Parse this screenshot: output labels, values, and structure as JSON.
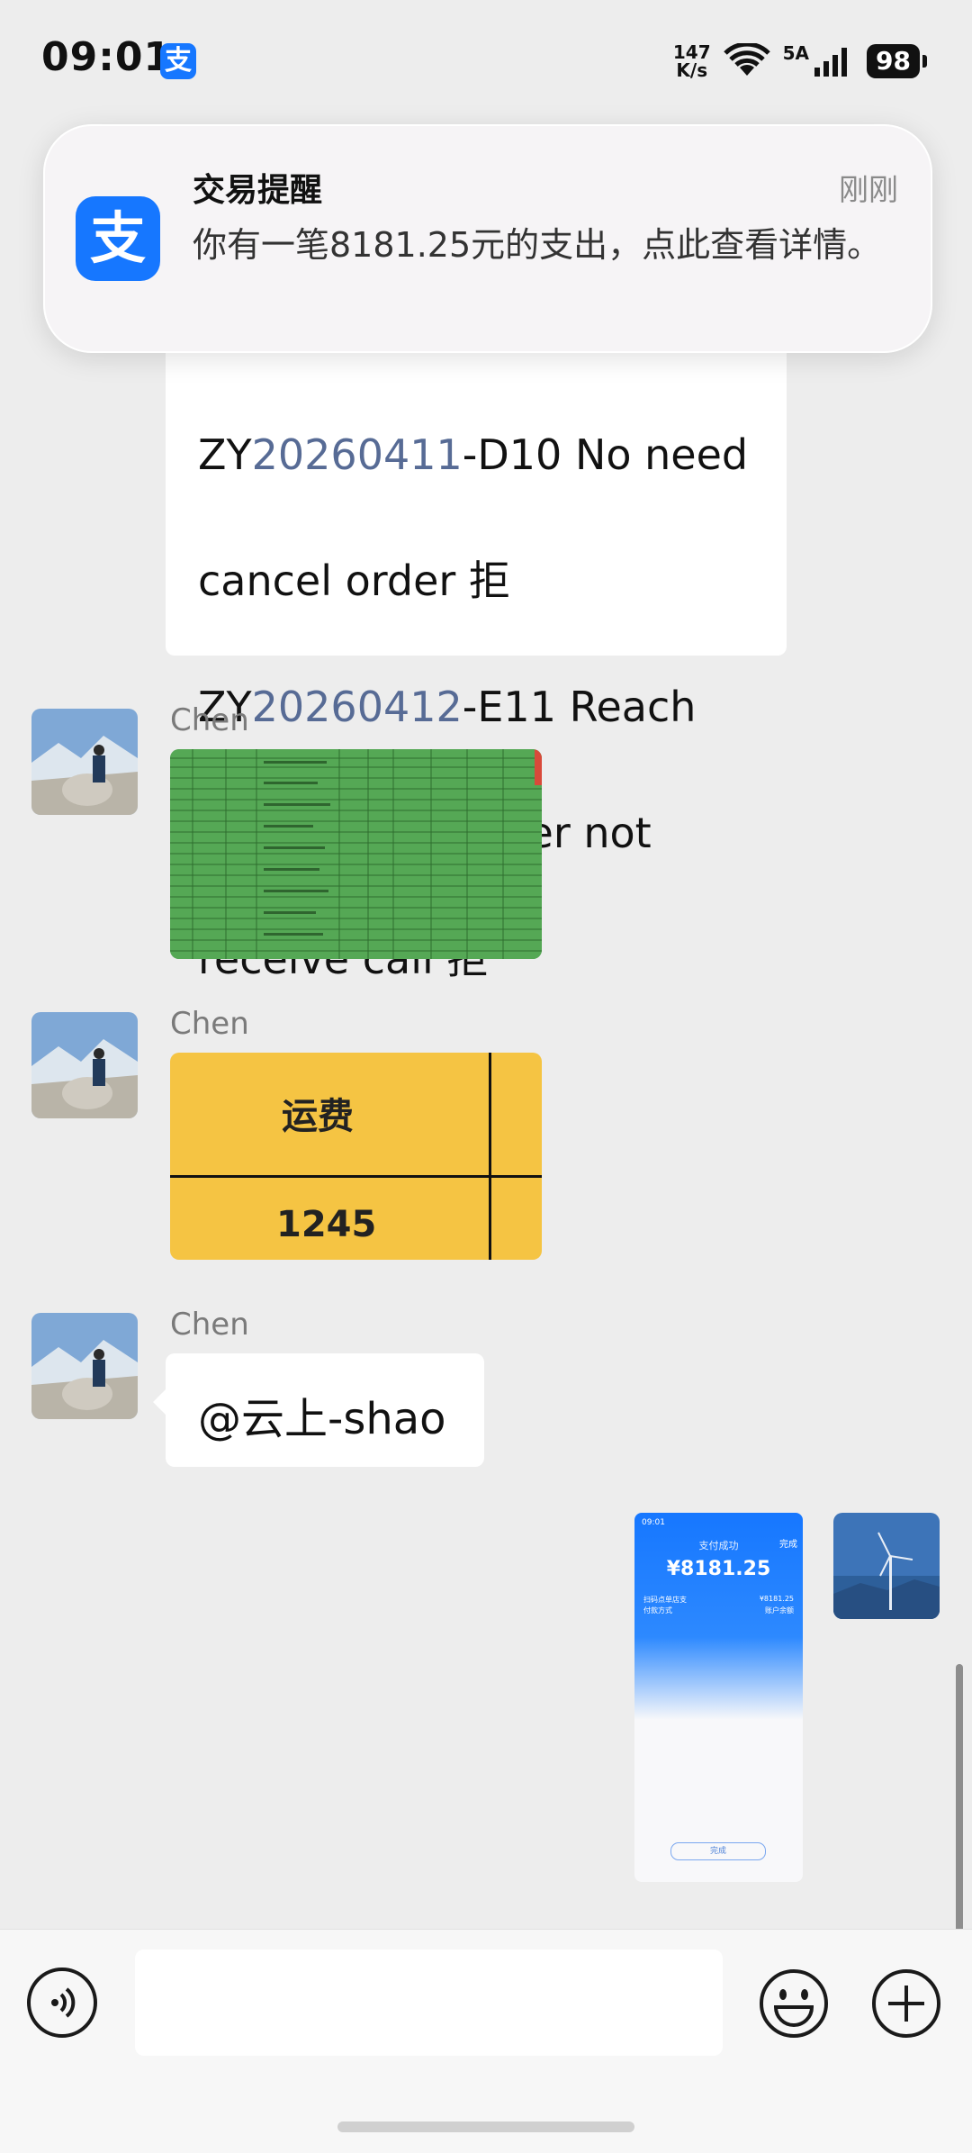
{
  "status_bar": {
    "time": "09:01",
    "app_icon_glyph": "支",
    "net_speed_value": "147",
    "net_speed_unit": "K/s",
    "network_type": "5A",
    "battery": "98"
  },
  "notification": {
    "app_icon_glyph": "支",
    "title": "交易提醒",
    "time": "刚刚",
    "body": "你有一笔8181.25元的支出，点此查看详情。"
  },
  "previous_message": {
    "line1_prefix": "ZY",
    "line1_link": "20260411",
    "line1_suffix": "-D10 No need",
    "line2": "cancel order 拒",
    "line3_prefix": "ZY",
    "line3_link": "20260412",
    "line3_suffix": "-E11 Reach",
    "line4": "location customer not",
    "line5": "receive call 拒"
  },
  "messages": [
    {
      "sender": "Chen",
      "type": "image-spreadsheet"
    },
    {
      "sender": "Chen",
      "type": "image-table",
      "header": "运费",
      "value": "1245"
    },
    {
      "sender": "Chen",
      "type": "text",
      "text": "@云上-shao"
    }
  ],
  "my_images": {
    "payment_screenshot": {
      "title": "支付成功",
      "amount": "¥8181.25",
      "row1_left": "扫码点单店支",
      "row1_right": "¥8181.25",
      "row2_left": "付款方式",
      "row2_right": "账户余额",
      "done_label": "完成",
      "top_right_label": "完成"
    }
  },
  "input_bar": {
    "placeholder": ""
  },
  "icons": {
    "voice": "voice-icon",
    "emoji": "emoji-icon",
    "plus": "plus-icon"
  },
  "colors": {
    "alipay_blue": "#1677ff",
    "link": "#576b95",
    "chat_bg": "#ededed"
  }
}
